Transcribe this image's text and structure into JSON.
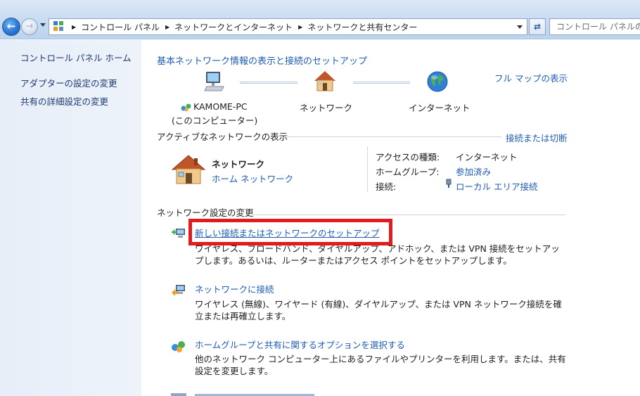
{
  "address_bar": {
    "crumbs": [
      "コントロール パネル",
      "ネットワークとインターネット",
      "ネットワークと共有センター"
    ],
    "search_placeholder": "コントロール パネルの検索"
  },
  "sidebar": {
    "items": [
      {
        "label": "コントロール パネル ホーム"
      },
      {
        "label": "アダプターの設定の変更"
      },
      {
        "label": "共有の詳細設定の変更"
      }
    ]
  },
  "network_map": {
    "title": "基本ネットワーク情報の表示と接続のセットアップ",
    "full_map_link": "フル マップの表示",
    "computer_name": "KAMOME-PC",
    "computer_sub": "(このコンピューター)",
    "network_label": "ネットワーク",
    "internet_label": "インターネット"
  },
  "active_networks": {
    "heading": "アクティブなネットワークの表示",
    "connect_link": "接続または切断",
    "network_name": "ネットワーク",
    "network_type": "ホーム ネットワーク",
    "access_type_label": "アクセスの種類:",
    "access_type_value": "インターネット",
    "homegroup_label": "ホームグループ:",
    "homegroup_value": "参加済み",
    "connections_label": "接続:",
    "connections_value": "ローカル エリア接続"
  },
  "change_settings": {
    "heading": "ネットワーク設定の変更",
    "tasks": [
      {
        "link": "新しい接続またはネットワークのセットアップ",
        "desc": "ワイヤレス、ブロードバンド、ダイヤルアップ、アドホック、または VPN 接続をセットアップします。あるいは、ルーターまたはアクセス ポイントをセットアップします。"
      },
      {
        "link": "ネットワークに接続",
        "desc": "ワイヤレス (無線)、ワイヤード (有線)、ダイヤルアップ、または VPN ネットワーク接続を確立または再確立します。"
      },
      {
        "link": "ホームグループと共有に関するオプションを選択する",
        "desc": "他のネットワーク コンピューター上にあるファイルやプリンターを利用します。または、共有設定を変更します。"
      }
    ]
  },
  "colors": {
    "highlight": "#e01c1c",
    "link": "#1e5cb3",
    "sidebar_bg": "#e7eef8"
  }
}
